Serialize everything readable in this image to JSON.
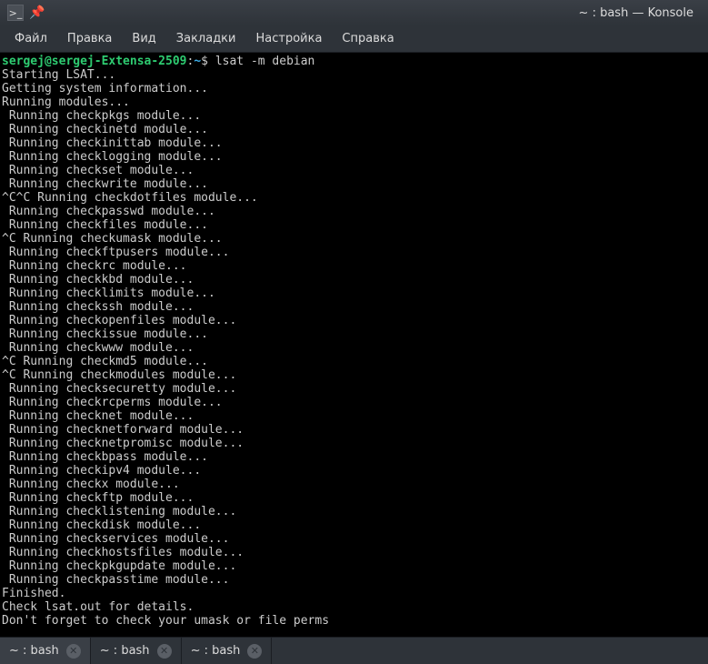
{
  "window": {
    "title": "~ : bash — Konsole"
  },
  "menubar": {
    "items": [
      "Файл",
      "Правка",
      "Вид",
      "Закладки",
      "Настройка",
      "Справка"
    ]
  },
  "prompt": {
    "user_host": "sergej@sergej-Extensa-2509",
    "colon": ":",
    "path": "~",
    "symbol": "$",
    "command": "lsat -m debian"
  },
  "output_lines": [
    "Starting LSAT...",
    "Getting system information...",
    "Running modules...",
    " Running checkpkgs module...",
    " Running checkinetd module...",
    " Running checkinittab module...",
    " Running checklogging module...",
    " Running checkset module...",
    " Running checkwrite module...",
    "^C^C Running checkdotfiles module...",
    " Running checkpasswd module...",
    " Running checkfiles module...",
    "^C Running checkumask module...",
    " Running checkftpusers module...",
    " Running checkrc module...",
    " Running checkkbd module...",
    " Running checklimits module...",
    " Running checkssh module...",
    " Running checkopenfiles module...",
    " Running checkissue module...",
    " Running checkwww module...",
    "^C Running checkmd5 module...",
    "^C Running checkmodules module...",
    " Running checksecuretty module...",
    " Running checkrcperms module...",
    " Running checknet module...",
    " Running checknetforward module...",
    " Running checknetpromisc module...",
    " Running checkbpass module...",
    " Running checkipv4 module...",
    " Running checkx module...",
    " Running checkftp module...",
    " Running checklistening module...",
    " Running checkdisk module...",
    " Running checkservices module...",
    " Running checkhostsfiles module...",
    " Running checkpkgupdate module...",
    " Running checkpasstime module...",
    "Finished.",
    "Check lsat.out for details.",
    "Don't forget to check your umask or file perms"
  ],
  "tabs": {
    "items": [
      {
        "label": "~ : bash"
      },
      {
        "label": "~ : bash"
      },
      {
        "label": "~ : bash"
      }
    ],
    "close_glyph": "✕"
  },
  "icons": {
    "app_glyph": ">_",
    "pin_glyph": "📌"
  }
}
